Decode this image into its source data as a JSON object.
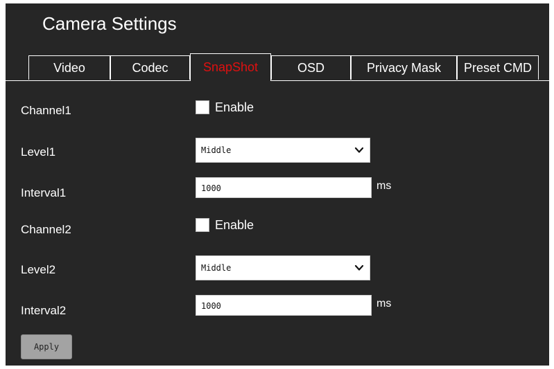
{
  "page_title": "Camera Settings",
  "tabs": [
    {
      "label": "Video",
      "active": false
    },
    {
      "label": "Codec",
      "active": false
    },
    {
      "label": "SnapShot",
      "active": true
    },
    {
      "label": "OSD",
      "active": false
    },
    {
      "label": "Privacy Mask",
      "active": false
    },
    {
      "label": "Preset CMD",
      "active": false
    }
  ],
  "colors": {
    "background": "#262626",
    "active_tab_text": "#e01010",
    "apply_button": "#a3a3a3"
  },
  "channel1": {
    "label": "Channel1",
    "enable_label": "Enable",
    "enabled": false,
    "level_label": "Level1",
    "level_value": "Middle",
    "interval_label": "Interval1",
    "interval_value": "1000",
    "interval_unit": "ms"
  },
  "channel2": {
    "label": "Channel2",
    "enable_label": "Enable",
    "enabled": false,
    "level_label": "Level2",
    "level_value": "Middle",
    "interval_label": "Interval2",
    "interval_value": "1000",
    "interval_unit": "ms"
  },
  "apply_label": "Apply",
  "icons": {
    "dropdown": "chevron-down-icon"
  }
}
